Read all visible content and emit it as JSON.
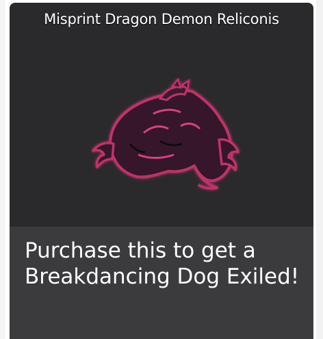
{
  "card": {
    "title": "Misprint Dragon Demon Reliconis",
    "image_icon": "dragon-silhouette-icon",
    "description": "Purchase this to get a Breakdancing Dog Exiled!"
  },
  "colors": {
    "card_bg": "#2a2a2c",
    "footer_bg": "#3b3b3d",
    "dragon_fill": "#3a1c2e",
    "dragon_glow": "#c0306a",
    "text": "#ffffff"
  }
}
